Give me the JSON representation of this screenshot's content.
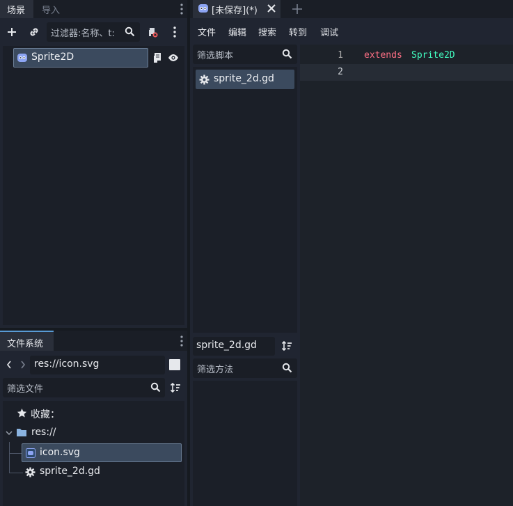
{
  "scene_dock": {
    "tabs": [
      "场景",
      "导入"
    ],
    "filter_placeholder": "过滤器:名称、t:",
    "root_node": {
      "label": "Sprite2D"
    }
  },
  "filesystem_dock": {
    "tab": "文件系统",
    "path": "res://icon.svg",
    "filter_placeholder": "筛选文件",
    "tree": {
      "favorites": "收藏：",
      "res_root": "res://",
      "files": [
        "icon.svg",
        "sprite_2d.gd"
      ]
    }
  },
  "script_editor": {
    "tab_title": "[未保存](*)",
    "menu": [
      "文件",
      "编辑",
      "搜索",
      "转到",
      "调试"
    ],
    "script_filter_placeholder": "筛选脚本",
    "script_list": [
      "sprite_2d.gd"
    ],
    "current_script": "sprite_2d.gd",
    "method_filter_placeholder": "筛选方法",
    "code_lines": [
      {
        "number": "1",
        "keyword": "extends",
        "type": "Sprite2D"
      },
      {
        "number": "2",
        "keyword": "",
        "type": ""
      }
    ],
    "colors": {
      "keyword": "#ff7085",
      "type": "#42ffc2",
      "line_number": "#aaaaaa",
      "accent": "#589ad4"
    }
  }
}
